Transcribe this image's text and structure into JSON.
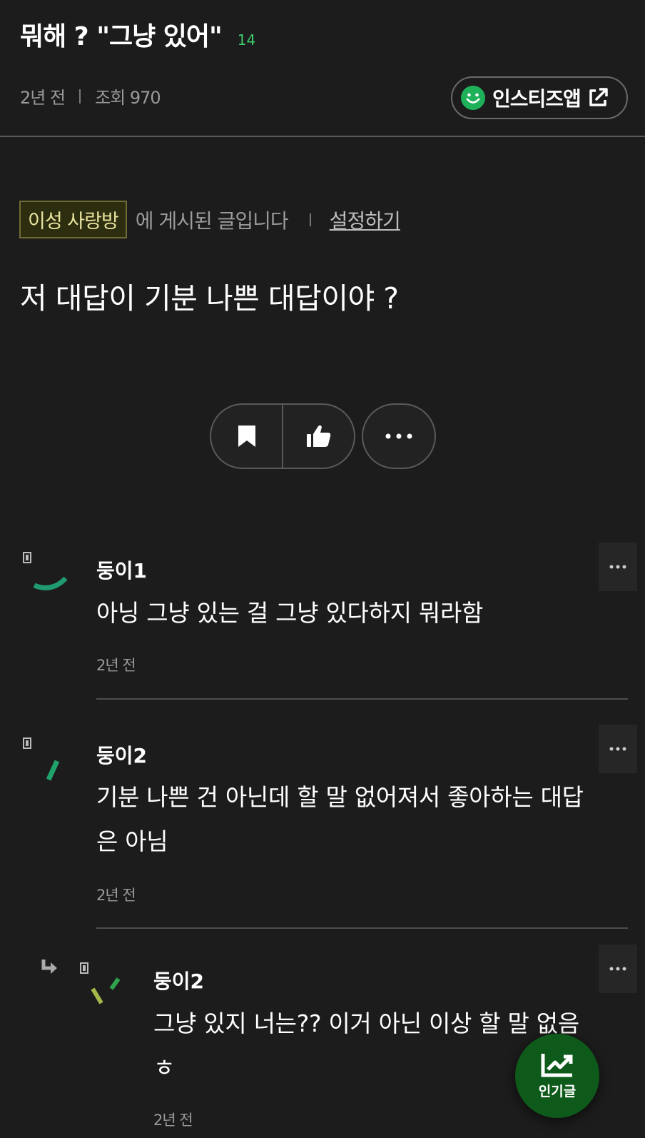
{
  "header": {
    "title": "뭐해 ? \"그냥 있어\"",
    "comment_count": "14",
    "time": "2년 전",
    "views": "조회 970",
    "app_button_label": "인스티즈앱"
  },
  "board": {
    "name": "이성 사랑방",
    "suffix": "에 게시된 글입니다",
    "settings_label": "설정하기"
  },
  "post": {
    "body": "저 대답이 기분 나쁜 대답이야 ?"
  },
  "comments": [
    {
      "author": "둥이1",
      "text": "아닝 그냥 있는 걸 그냥 있다하지 뭐라함",
      "time": "2년 전"
    },
    {
      "author": "둥이2",
      "text_line1": "기분 나쁜 건 아닌데 할 말 없어져서 좋아하는 대답",
      "text_line2": "은 아님",
      "time": "2년 전"
    },
    {
      "author": "둥이2",
      "text_line1": "그냥 있지 너는?? 이거 아닌 이상 할 말 없음",
      "text_line2": "ㅎ",
      "time": "2년 전",
      "is_reply": true
    }
  ],
  "fab": {
    "label": "인기글"
  },
  "colors": {
    "background": "#1c1c1c",
    "accent_green": "#3fcf6b",
    "fab_green": "#0e5a1a"
  },
  "icons": [
    "smile-icon",
    "external-link-icon",
    "bookmark-icon",
    "thumbs-up-icon",
    "more-horizontal-icon",
    "reply-arrow-icon",
    "trending-up-icon"
  ]
}
